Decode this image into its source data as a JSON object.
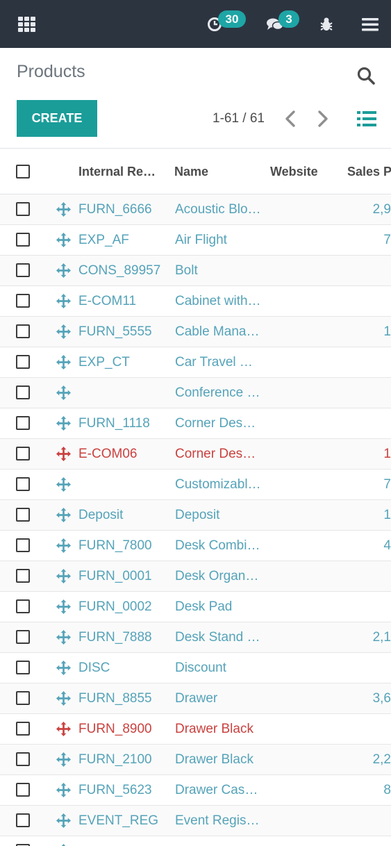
{
  "topbar": {
    "activity_count": "30",
    "message_count": "3",
    "icons": [
      "apps-icon",
      "clock-icon",
      "chat-icon",
      "bug-icon",
      "menu-icon"
    ],
    "background": "#2c3440",
    "badge_color": "#1ea5a5"
  },
  "control_panel": {
    "title": "Products",
    "create_label": "CREATE",
    "pager": "1-61 / 61",
    "accent": "#1a9d99"
  },
  "table": {
    "headers": {
      "internal_ref": "Internal Re…",
      "name": "Name",
      "website": "Website",
      "sales_price": "Sales P"
    },
    "colors": {
      "normal": "#55a3b9",
      "danger": "#c9423f"
    },
    "rows": [
      {
        "ref": "FURN_6666",
        "name": "Acoustic Blo…",
        "website": "",
        "sales": "2,9",
        "danger": false
      },
      {
        "ref": "EXP_AF",
        "name": "Air Flight",
        "website": "",
        "sales": "7",
        "danger": false
      },
      {
        "ref": "CONS_89957",
        "name": "Bolt",
        "website": "",
        "sales": "",
        "danger": false
      },
      {
        "ref": "E-COM11",
        "name": "Cabinet with…",
        "website": "",
        "sales": "",
        "danger": false
      },
      {
        "ref": "FURN_5555",
        "name": "Cable Mana…",
        "website": "",
        "sales": "1",
        "danger": false
      },
      {
        "ref": "EXP_CT",
        "name": "Car Travel Ex…",
        "website": "",
        "sales": "",
        "danger": false
      },
      {
        "ref": "",
        "name": "Conference …",
        "website": "",
        "sales": "",
        "danger": false
      },
      {
        "ref": "FURN_1118",
        "name": "Corner Desk …",
        "website": "",
        "sales": "",
        "danger": false
      },
      {
        "ref": "E-COM06",
        "name": "Corner Desk …",
        "website": "",
        "sales": "1",
        "danger": true
      },
      {
        "ref": "",
        "name": "Customizabl…",
        "website": "",
        "sales": "7",
        "danger": false
      },
      {
        "ref": "Deposit",
        "name": "Deposit",
        "website": "",
        "sales": "1",
        "danger": false
      },
      {
        "ref": "FURN_7800",
        "name": "Desk Combi…",
        "website": "",
        "sales": "4",
        "danger": false
      },
      {
        "ref": "FURN_0001",
        "name": "Desk Organi…",
        "website": "",
        "sales": "",
        "danger": false
      },
      {
        "ref": "FURN_0002",
        "name": "Desk Pad",
        "website": "",
        "sales": "",
        "danger": false
      },
      {
        "ref": "FURN_7888",
        "name": "Desk Stand …",
        "website": "",
        "sales": "2,1",
        "danger": false
      },
      {
        "ref": "DISC",
        "name": "Discount",
        "website": "",
        "sales": "",
        "danger": false
      },
      {
        "ref": "FURN_8855",
        "name": "Drawer",
        "website": "",
        "sales": "3,6",
        "danger": false
      },
      {
        "ref": "FURN_8900",
        "name": "Drawer Black",
        "website": "",
        "sales": "",
        "danger": true
      },
      {
        "ref": "FURN_2100",
        "name": "Drawer Black",
        "website": "",
        "sales": "2,2",
        "danger": false
      },
      {
        "ref": "FURN_5623",
        "name": "Drawer Case…",
        "website": "",
        "sales": "8",
        "danger": false
      },
      {
        "ref": "EVENT_REG",
        "name": "Event Regist…",
        "website": "",
        "sales": "",
        "danger": false
      }
    ]
  }
}
